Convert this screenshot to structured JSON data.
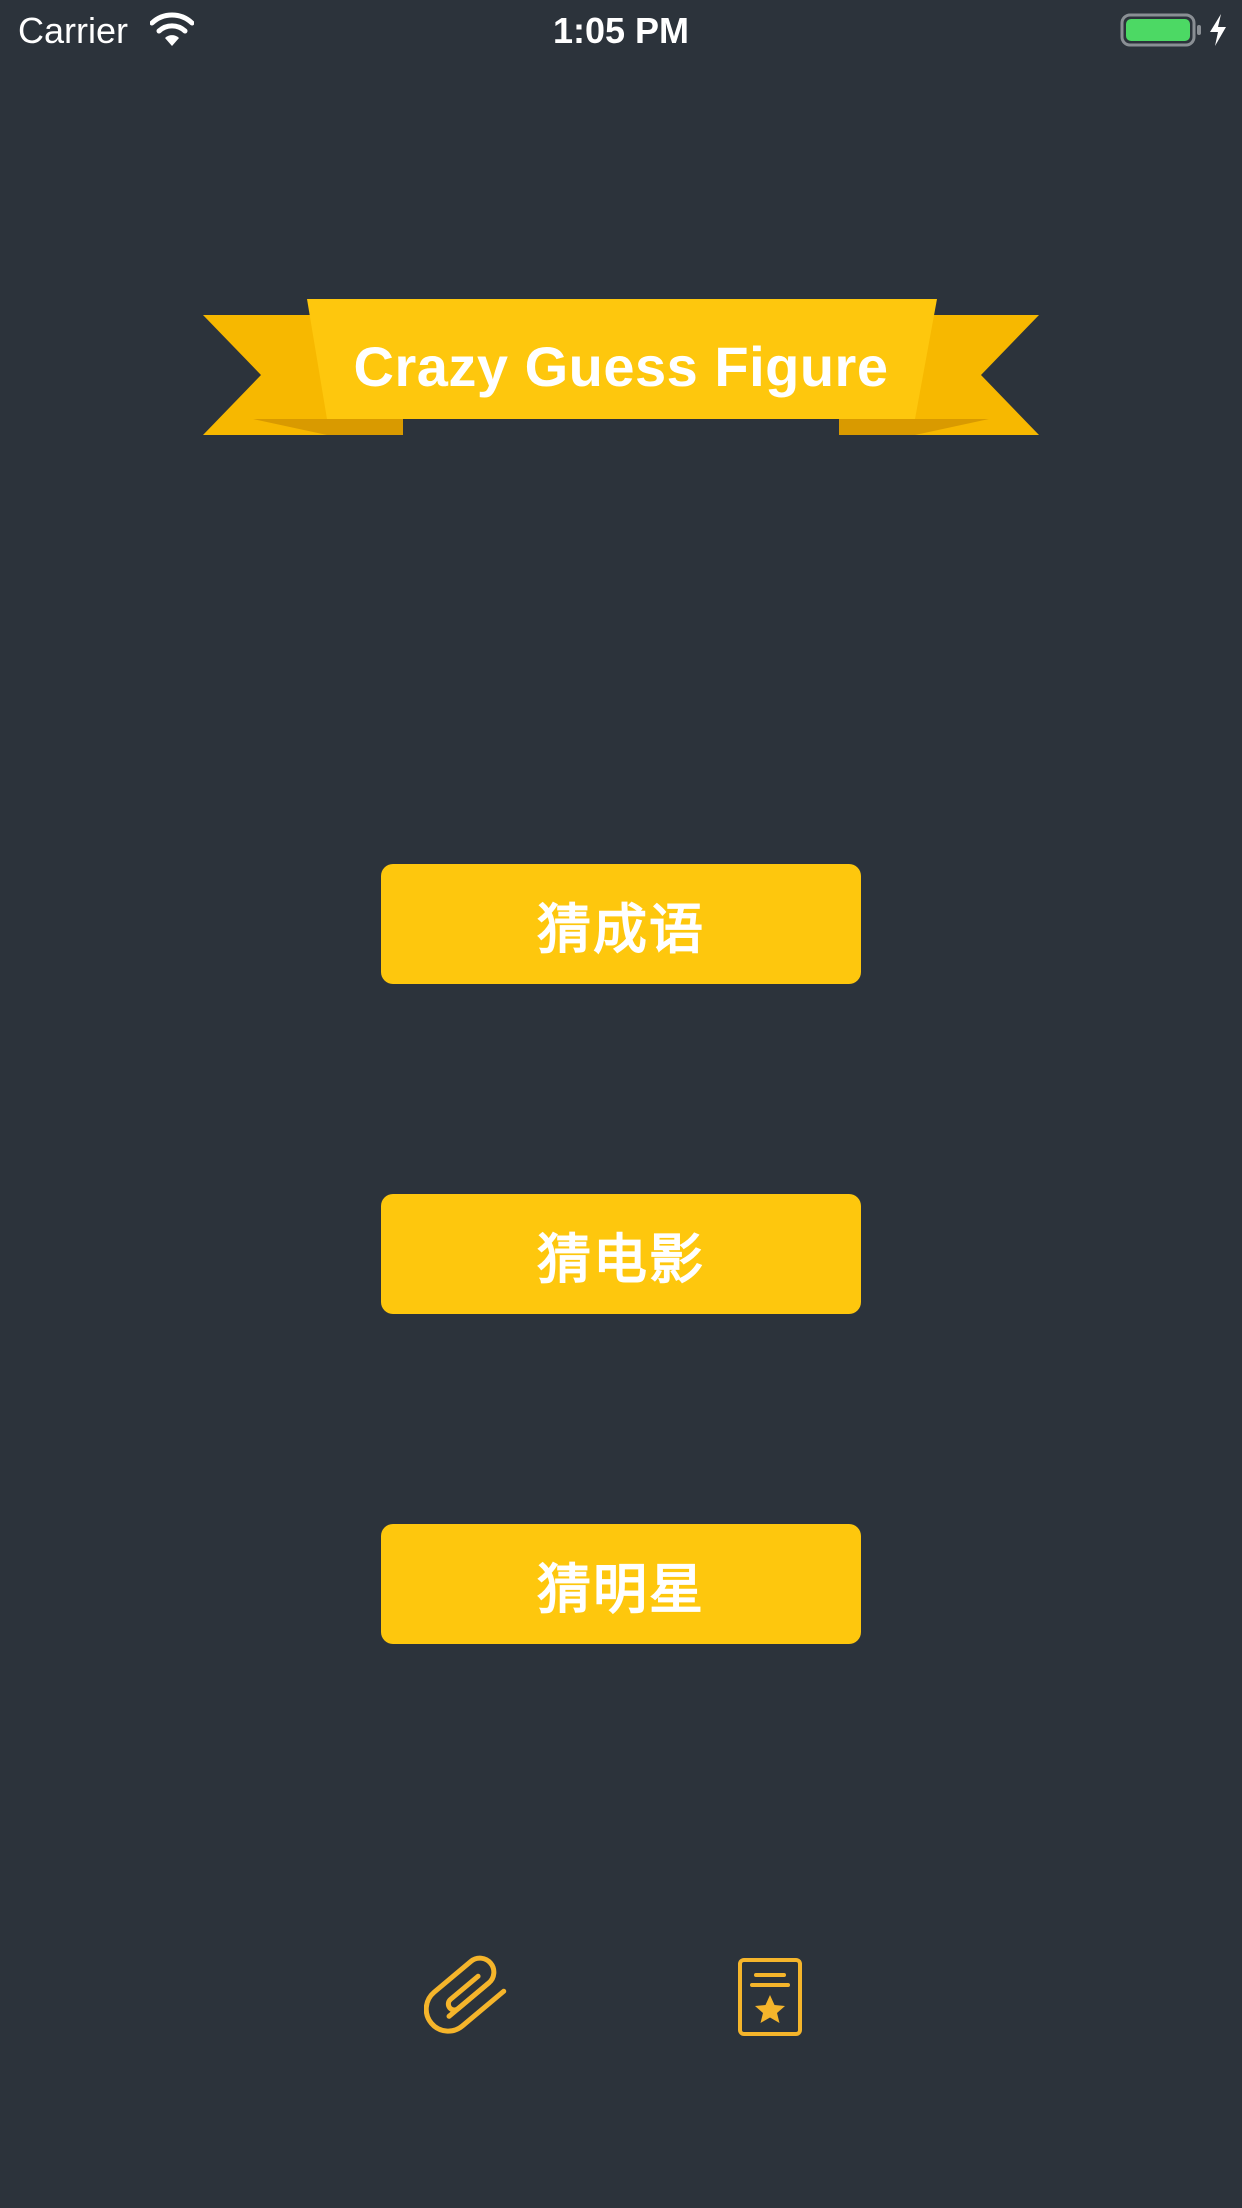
{
  "status_bar": {
    "carrier": "Carrier",
    "time": "1:05 PM",
    "icons": [
      "wifi-icon",
      "battery-icon",
      "charging-icon"
    ],
    "battery_color": "#4cd964"
  },
  "header": {
    "title": "Crazy Guess Figure",
    "ribbon_color": "#fec70d"
  },
  "menu": {
    "buttons": [
      {
        "label": "猜成语"
      },
      {
        "label": "猜电影"
      },
      {
        "label": "猜明星"
      }
    ],
    "button_color": "#fec70d"
  },
  "bottom_bar": {
    "icons": [
      "paperclip-icon",
      "badge-doc-icon"
    ],
    "icon_color": "#f5b52b"
  },
  "colors": {
    "background": "#2c333b",
    "accent": "#fec70d",
    "text": "#ffffff"
  }
}
